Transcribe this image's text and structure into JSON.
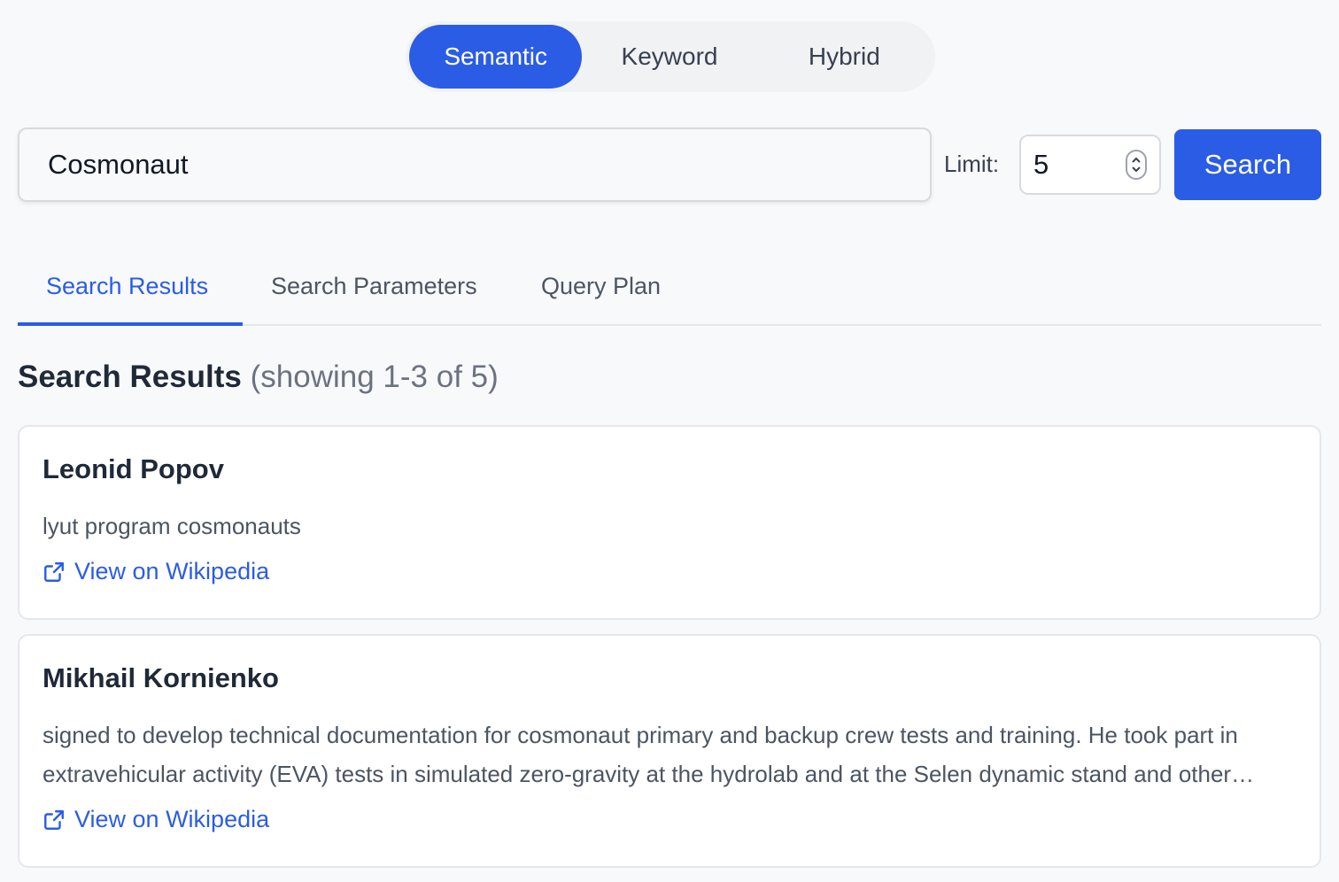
{
  "mode_toggle": {
    "options": [
      "Semantic",
      "Keyword",
      "Hybrid"
    ],
    "selected": "Semantic"
  },
  "search": {
    "value": "Cosmonaut",
    "limit_label": "Limit:",
    "limit_value": "5",
    "button_label": "Search"
  },
  "tabs": [
    {
      "label": "Search Results",
      "active": true
    },
    {
      "label": "Search Parameters",
      "active": false
    },
    {
      "label": "Query Plan",
      "active": false
    }
  ],
  "results": {
    "heading": "Search Results",
    "subheading": "(showing 1-3 of 5)",
    "items": [
      {
        "title": "Leonid Popov",
        "snippet": "lyut program cosmonauts",
        "link_label": "View on Wikipedia",
        "link_icon": "external-link-icon"
      },
      {
        "title": "Mikhail Kornienko",
        "snippet": "signed to develop technical documentation for cosmonaut primary and backup crew tests and training. He took part in extravehicular activity (EVA) tests in simulated zero-gravity at the hydrolab and at the Selen dynamic stand and other facilities used in cosmonaut training.",
        "link_label": "View on Wikipedia",
        "link_icon": "external-link-icon"
      }
    ]
  },
  "colors": {
    "accent": "#2b5ce6",
    "background": "#f8f9fb",
    "card": "#ffffff"
  }
}
